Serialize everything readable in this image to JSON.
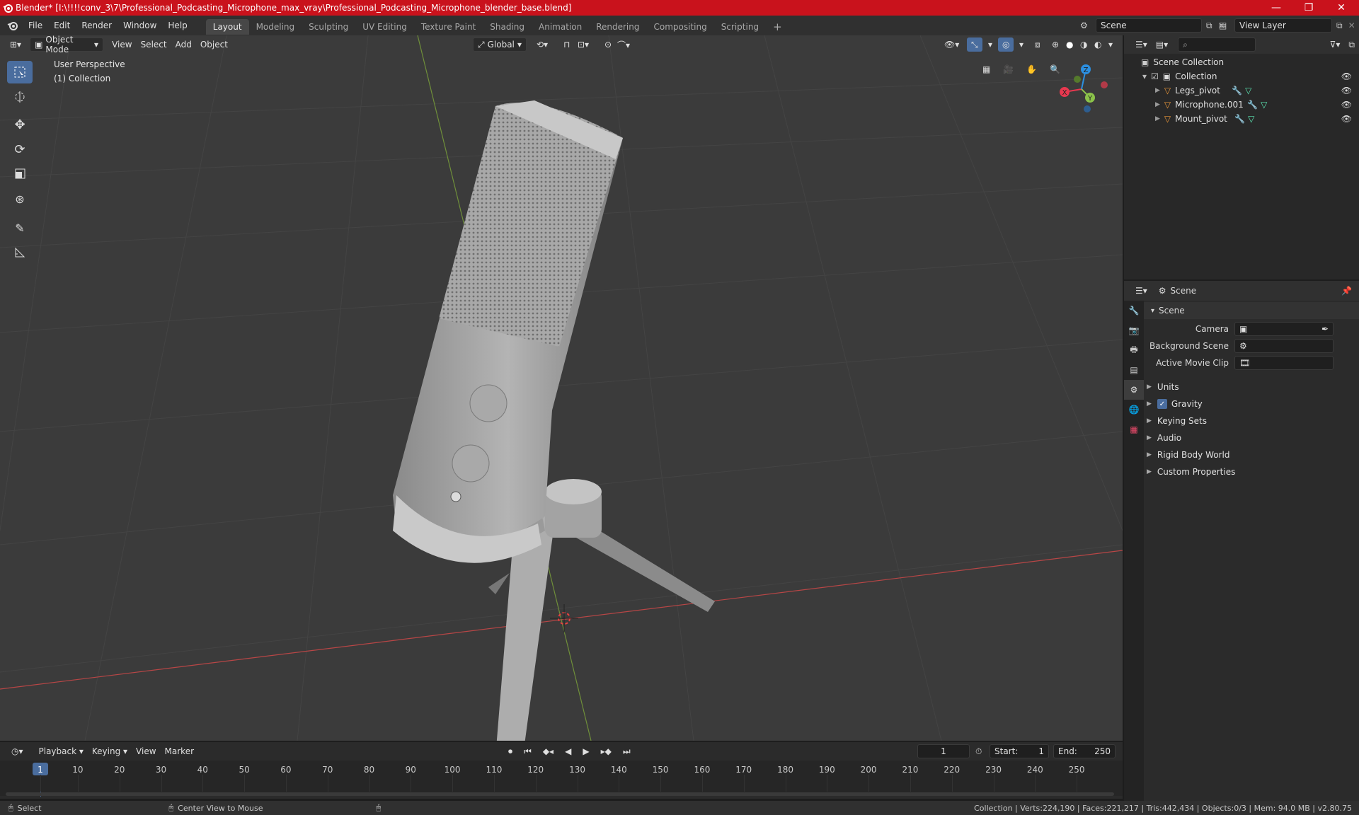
{
  "titlebar": {
    "title": "Blender* [I:\\!!!!conv_3\\7\\Professional_Podcasting_Microphone_max_vray\\Professional_Podcasting_Microphone_blender_base.blend]",
    "minimize": "—",
    "maximize": "❐",
    "close": "✕"
  },
  "menu": {
    "items": [
      "File",
      "Edit",
      "Render",
      "Window",
      "Help"
    ]
  },
  "workspaces": {
    "tabs": [
      "Layout",
      "Modeling",
      "Sculpting",
      "UV Editing",
      "Texture Paint",
      "Shading",
      "Animation",
      "Rendering",
      "Compositing",
      "Scripting"
    ],
    "active": "Layout",
    "add": "+"
  },
  "scene_selector": {
    "value": "Scene"
  },
  "view_layer_selector": {
    "value": "View Layer"
  },
  "viewport": {
    "mode": "Object Mode",
    "menus": [
      "View",
      "Select",
      "Add",
      "Object"
    ],
    "transform_orientation": "Global",
    "info_line1": "User Perspective",
    "info_line2": "(1) Collection",
    "gizmo": {
      "x": "X",
      "y": "Y",
      "z": "Z"
    }
  },
  "outliner": {
    "root": "Scene Collection",
    "collection": "Collection",
    "objects": [
      "Legs_pivot",
      "Microphone.001",
      "Mount_pivot"
    ]
  },
  "properties": {
    "header_title": "Scene",
    "panel_title": "Scene",
    "fields": {
      "camera_label": "Camera",
      "background_scene_label": "Background Scene",
      "active_movie_clip_label": "Active Movie Clip"
    },
    "subpanels": [
      "Units",
      "Gravity",
      "Keying Sets",
      "Audio",
      "Rigid Body World",
      "Custom Properties"
    ],
    "gravity_checked": true
  },
  "timeline": {
    "menus": [
      "Playback",
      "Keying",
      "View",
      "Marker"
    ],
    "current_frame": "1",
    "start_label": "Start:",
    "start_value": "1",
    "end_label": "End:",
    "end_value": "250",
    "ticks": [
      "1",
      "10",
      "20",
      "30",
      "40",
      "50",
      "60",
      "70",
      "80",
      "90",
      "100",
      "110",
      "120",
      "130",
      "140",
      "150",
      "160",
      "170",
      "180",
      "190",
      "200",
      "210",
      "220",
      "230",
      "240",
      "250"
    ]
  },
  "statusbar": {
    "select": "Select",
    "center_view": "Center View to Mouse",
    "stats": "Collection | Verts:224,190 | Faces:221,217 | Tris:442,434 | Objects:0/3 | Mem: 94.0 MB | v2.80.75"
  },
  "colors": {
    "titlebar": "#c9121c",
    "accent": "#4a6d9e",
    "x_axis": "#e8384f",
    "y_axis": "#8bc34a",
    "z_axis": "#2c8fe0",
    "object_icon": "#e8963a"
  }
}
